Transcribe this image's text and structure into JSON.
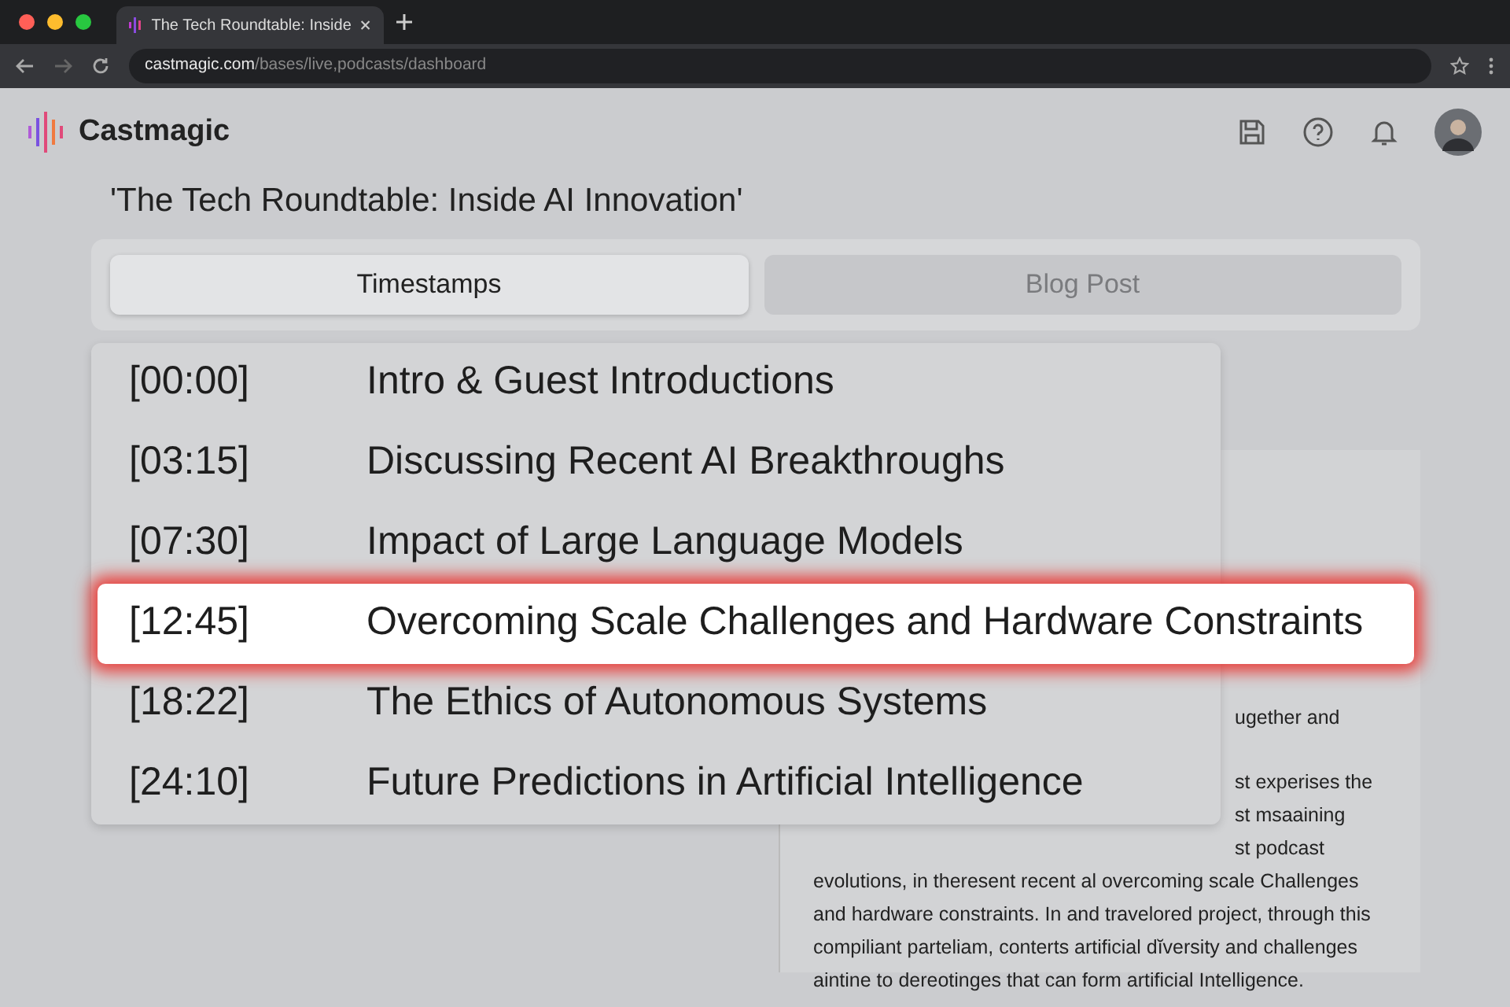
{
  "browser": {
    "tab_title": "The Tech Roundtable: Inside",
    "url_host": "castmagic.com",
    "url_path": "/bases/live,podcasts/dashboard"
  },
  "app": {
    "brand": "Castmagic"
  },
  "page_title": "'The Tech Roundtable: Inside AI Innovation'",
  "tabs": [
    {
      "label": "Timestamps",
      "selected": true
    },
    {
      "label": "Blog Post",
      "selected": false
    }
  ],
  "timestamps": [
    {
      "time": "[00:00]",
      "title": "Intro & Guest Introductions",
      "selected": false
    },
    {
      "time": "[03:15]",
      "title": "Discussing Recent AI Breakthroughs",
      "selected": false
    },
    {
      "time": "[07:30]",
      "title": "Impact of Large Language Models",
      "selected": false
    },
    {
      "time": "[12:45]",
      "title": "Overcoming Scale Challenges and Hardware Constraints",
      "selected": true
    },
    {
      "time": "[18:22]",
      "title": "The Ethics of Autonomous Systems",
      "selected": false
    },
    {
      "time": "[24:10]",
      "title": "Future Predictions in Artificial Intelligence",
      "selected": false
    }
  ],
  "blog_lines": [
    {
      "kind": "fragment",
      "text": "ugether and"
    },
    {
      "kind": "fragment",
      "text": "st experises the"
    },
    {
      "kind": "fragment",
      "text": "st msaaining"
    },
    {
      "kind": "fragment",
      "text": "st podcast"
    },
    {
      "kind": "full",
      "text": "evolutions, in theresent recent al overcoming scale Challenges"
    },
    {
      "kind": "full",
      "text": "and hardware constraints. In and travelored project, through this"
    },
    {
      "kind": "full",
      "text": "compiliant parteliam, conterts artificial dĭversity and challenges"
    },
    {
      "kind": "full",
      "text": "aintine to dereotinges that can form artificial Intelligence."
    }
  ]
}
